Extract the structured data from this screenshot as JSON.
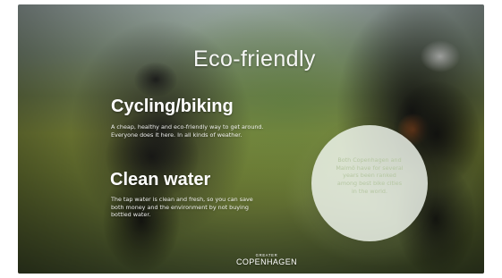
{
  "slide": {
    "title": "Eco-friendly",
    "sections": [
      {
        "heading": "Cycling/biking",
        "text": "A cheap, healthy and eco-friendly way to get around. Everyone does it here. In all kinds of weather."
      },
      {
        "heading": "Clean water",
        "text": "The tap water is clean and fresh, so you can save both money and the environment by not buying bottled water."
      }
    ],
    "callout": "Both Copenhagen and Malmö have for several years been ranked among best bike cities in the world.",
    "logo": {
      "small": "GREATER",
      "big": "COPENHAGEN"
    }
  },
  "colors": {
    "title_text": "#ffffff",
    "callout_circle": "#eef4ec",
    "callout_text": "#b6c7a4"
  }
}
